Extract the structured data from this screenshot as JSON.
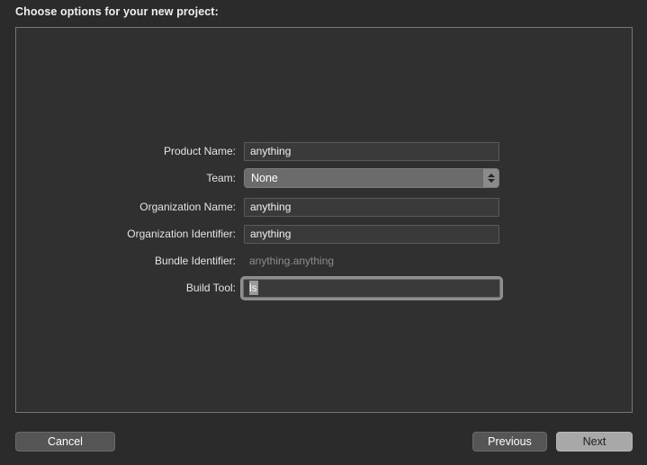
{
  "header": {
    "title": "Choose options for your new project:"
  },
  "form": {
    "rows": [
      {
        "label": "Product Name:",
        "type": "textfield",
        "value": "anything",
        "name": "product-name"
      },
      {
        "label": "Team:",
        "type": "popup",
        "value": "None",
        "name": "team"
      },
      {
        "label": "Organization Name:",
        "type": "textfield",
        "value": "anything",
        "name": "organization-name"
      },
      {
        "label": "Organization Identifier:",
        "type": "textfield",
        "value": "anything",
        "name": "organization-identifier"
      },
      {
        "label": "Bundle Identifier:",
        "type": "statictext",
        "value": "anything.anything",
        "name": "bundle-identifier"
      },
      {
        "label": "Build Tool:",
        "type": "textfield-focused",
        "value": "ls",
        "name": "build-tool"
      }
    ]
  },
  "buttons": {
    "cancel": "Cancel",
    "previous": "Previous",
    "next": "Next"
  },
  "icons": {
    "stepper": "chevron-up-down-icon"
  },
  "colors": {
    "window_background": "#2b2b2b",
    "panel_background": "#303030",
    "panel_border": "#757575",
    "field_background": "#3a3a3a",
    "popup_background": "#6b6b6b",
    "default_button_background": "#a8a8a8",
    "selection_highlight": "#9a9a9a",
    "dim_text": "#8d8d8d"
  }
}
